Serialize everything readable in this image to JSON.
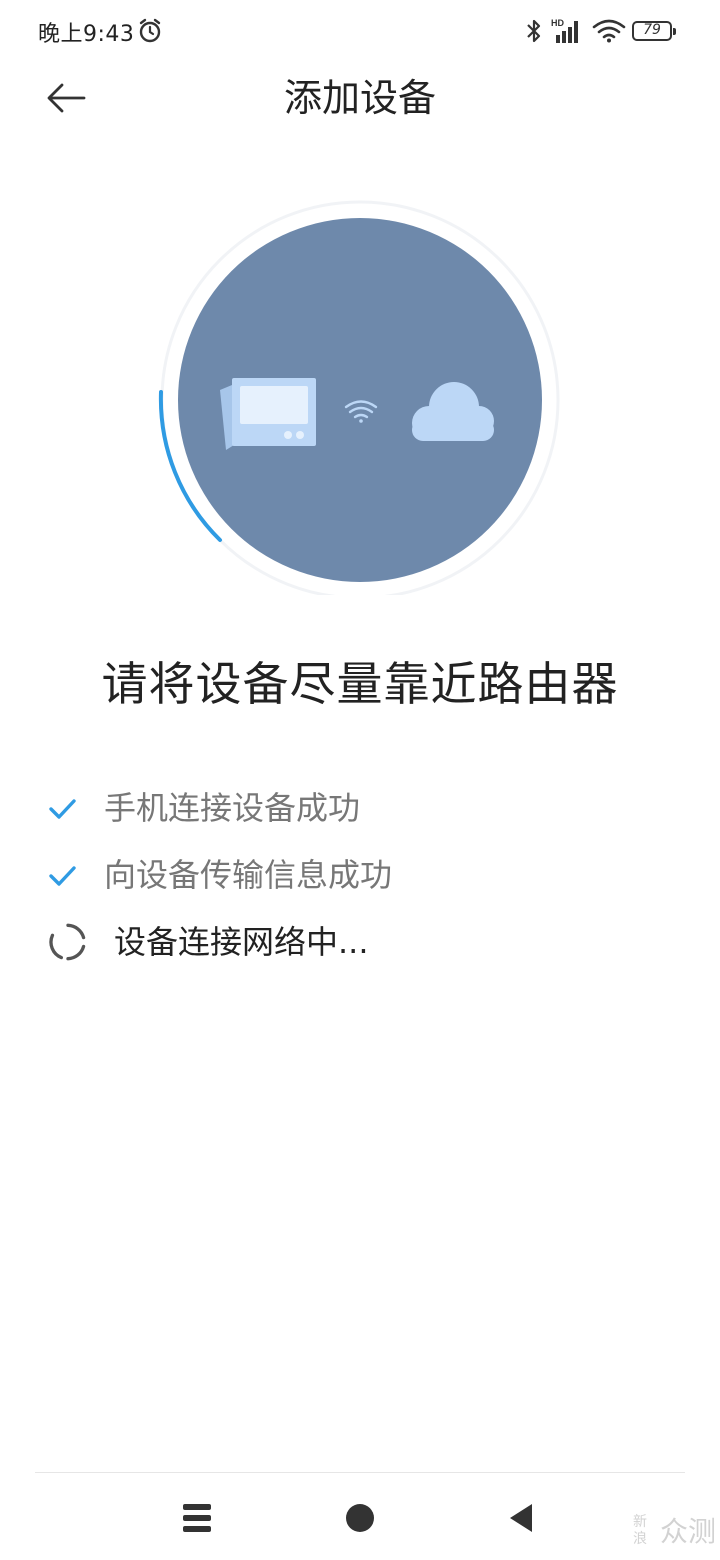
{
  "status_bar": {
    "time": "晚上9:43",
    "network_label": "HD",
    "battery_level": "79",
    "icons": [
      "alarm-icon",
      "bluetooth-icon",
      "cellular-signal-icon",
      "wifi-icon",
      "battery-icon"
    ]
  },
  "header": {
    "title": "添加设备",
    "back_icon": "arrow-left-icon"
  },
  "illustration": {
    "circle_color": "#6e89ab",
    "progress_arc_color": "#2f9be3",
    "device_icon": "device-tablet-icon",
    "connection_icon": "wifi-icon",
    "cloud_icon": "cloud-icon"
  },
  "main_message": "请将设备尽量靠近路由器",
  "steps": [
    {
      "label": "手机连接设备成功",
      "status": "done",
      "icon": "check-icon"
    },
    {
      "label": "向设备传输信息成功",
      "status": "done",
      "icon": "check-icon"
    },
    {
      "label": "设备连接网络中...",
      "status": "in-progress",
      "icon": "loading-spinner-icon"
    }
  ],
  "nav_bar": {
    "menu_icon": "menu-icon",
    "home_icon": "home-icon",
    "back_icon": "back-triangle-icon"
  },
  "watermark": {
    "text": "众测",
    "mark": "新浪"
  },
  "colors": {
    "accent": "#2f9be3",
    "circle": "#6e89ab",
    "text_primary": "#222222",
    "text_secondary": "#777777"
  }
}
